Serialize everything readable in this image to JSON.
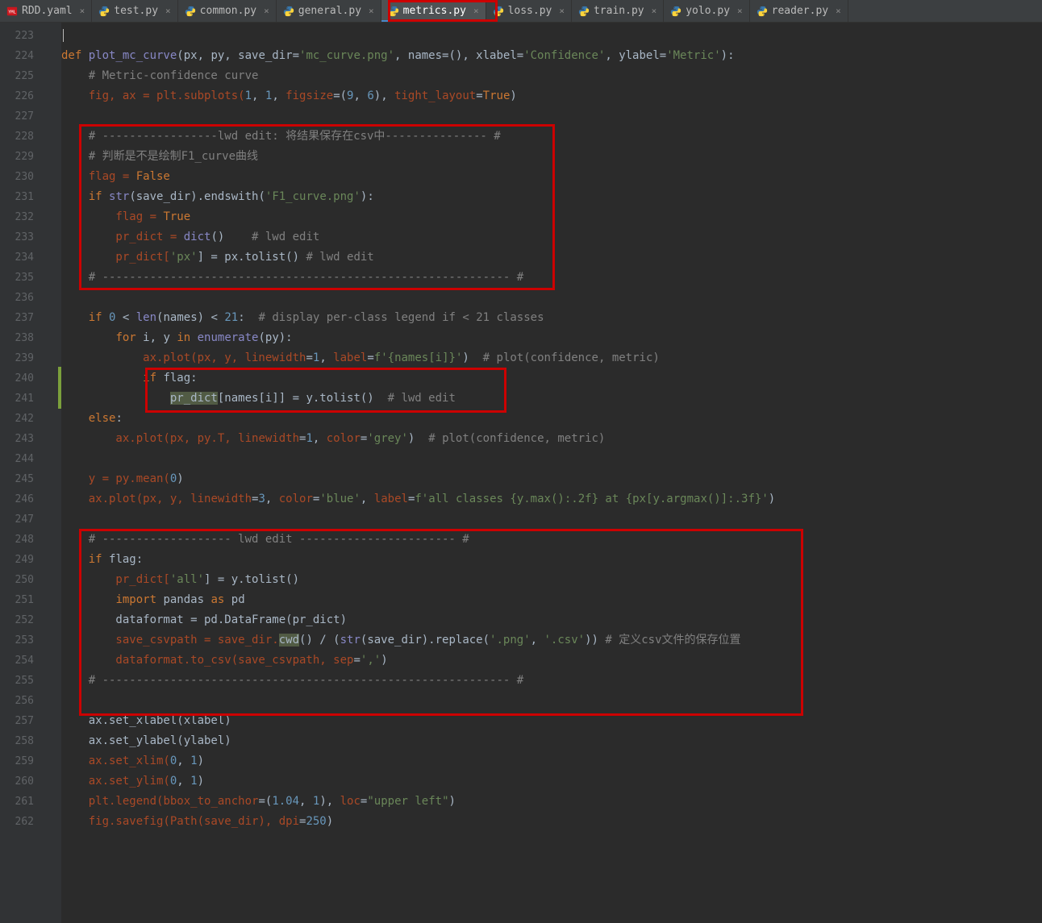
{
  "tabs": [
    {
      "name": "RDD.yaml",
      "type": "yaml",
      "active": false
    },
    {
      "name": "test.py",
      "type": "py",
      "active": false
    },
    {
      "name": "common.py",
      "type": "py",
      "active": false
    },
    {
      "name": "general.py",
      "type": "py",
      "active": false
    },
    {
      "name": "metrics.py",
      "type": "py",
      "active": true
    },
    {
      "name": "loss.py",
      "type": "py",
      "active": false
    },
    {
      "name": "train.py",
      "type": "py",
      "active": false
    },
    {
      "name": "yolo.py",
      "type": "py",
      "active": false
    },
    {
      "name": "reader.py",
      "type": "py",
      "active": false
    }
  ],
  "lineStart": 223,
  "lineEnd": 262,
  "code": {
    "l223": "",
    "l224": {
      "kw": "def ",
      "fn": "plot_mc_curve",
      "txt": "(px, py, save_dir=",
      "s1": "'mc_curve.png'",
      "c1": ", names=(), xlabel=",
      "s2": "'Confidence'",
      "c2": ", ylabel=",
      "s3": "'Metric'",
      "end": "):"
    },
    "l225": "    # Metric-confidence curve",
    "l226": {
      "pre": "    fig, ax = plt.subplots(",
      "n1": "1",
      "c1": ", ",
      "n2": "1",
      "c2": ", ",
      "p1": "figsize",
      "eq1": "=(",
      "n3": "9",
      "c3": ", ",
      "n4": "6",
      "end1": "), ",
      "p2": "tight_layout",
      "eq2": "=",
      "kw": "True",
      "end": ")"
    },
    "l227": "",
    "l228": "    # -----------------lwd edit: 将结果保存在csv中--------------- #",
    "l229": "    # 判断是不是绘制F1_curve曲线",
    "l230": {
      "pre": "    flag = ",
      "kw": "False"
    },
    "l231": {
      "pre": "    ",
      "kw": "if ",
      "fn": "str",
      "txt": "(save_dir).endswith(",
      "s": "'F1_curve.png'",
      "end": "):"
    },
    "l232": {
      "pre": "        flag = ",
      "kw": "True"
    },
    "l233": {
      "pre": "        pr_dict = ",
      "fn": "dict",
      "txt": "()    ",
      "com": "# lwd edit"
    },
    "l234": {
      "pre": "        pr_dict[",
      "s": "'px'",
      "txt": "] = px.tolist() ",
      "com": "# lwd edit"
    },
    "l235": "    # ------------------------------------------------------------ #",
    "l236": "",
    "l237": {
      "pre": "    ",
      "kw1": "if ",
      "n1": "0",
      "txt1": " < ",
      "fn": "len",
      "txt2": "(names) < ",
      "n2": "21",
      "txt3": ":  ",
      "com": "# display per-class legend if < 21 classes"
    },
    "l238": {
      "pre": "        ",
      "kw": "for ",
      "txt1": "i, y ",
      "kw2": "in ",
      "fn": "enumerate",
      "txt2": "(py):"
    },
    "l239": {
      "pre": "            ax.plot(px, y, ",
      "p1": "linewidth",
      "eq1": "=",
      "n1": "1",
      "c1": ", ",
      "p2": "label",
      "eq2": "=",
      "s1": "f'",
      "sb": "{",
      "se": "names[i]",
      "sb2": "}",
      "s2": "'",
      "txt": ")  ",
      "com": "# plot(confidence, metric)"
    },
    "l240": {
      "pre": "            ",
      "kw": "if ",
      "txt": "flag:"
    },
    "l241": {
      "pre": "                ",
      "hl": "pr_dict",
      "txt": "[names[i]] = y.tolist()  ",
      "com": "# lwd edit"
    },
    "l242": {
      "pre": "    ",
      "kw": "else",
      "txt": ":"
    },
    "l243": {
      "pre": "        ax.plot(px, py.T, ",
      "p1": "linewidth",
      "eq1": "=",
      "n1": "1",
      "c1": ", ",
      "p2": "color",
      "eq2": "=",
      "s": "'grey'",
      "txt": ")  ",
      "com": "# plot(confidence, metric)"
    },
    "l244": "",
    "l245": {
      "pre": "    y = py.mean(",
      "n": "0",
      "txt": ")"
    },
    "l246": {
      "pre": "    ax.plot(px, y, ",
      "p1": "linewidth",
      "eq1": "=",
      "n1": "3",
      "c1": ", ",
      "p2": "color",
      "eq2": "=",
      "s1": "'blue'",
      "c2": ", ",
      "p3": "label",
      "eq3": "=",
      "s2": "f'all classes ",
      "sb1": "{",
      "se1": "y.max()",
      "fmt1": ":.2f",
      "sb2": "}",
      "s3": " at ",
      "sb3": "{",
      "se2": "px[y.argmax()]",
      "fmt2": ":.3f",
      "sb4": "}",
      "s4": "'",
      "txt": ")"
    },
    "l247": "",
    "l248": "    # ------------------- lwd edit ----------------------- #",
    "l249": {
      "pre": "    ",
      "kw": "if ",
      "txt": "flag:"
    },
    "l250": {
      "pre": "        pr_dict[",
      "s": "'all'",
      "txt": "] = y.tolist()"
    },
    "l251": {
      "pre": "        ",
      "kw": "import ",
      "txt": "pandas ",
      "kw2": "as ",
      "txt2": "pd"
    },
    "l252": "        dataformat = pd.DataFrame(pr_dict)",
    "l253": {
      "pre": "        save_csvpath = save_dir.",
      "hl": "cwd",
      "txt": "() / (",
      "fn": "str",
      "txt2": "(save_dir).replace(",
      "s1": "'.png'",
      "c": ", ",
      "s2": "'.csv'",
      "txt3": ")) ",
      "com": "# 定义csv文件的保存位置"
    },
    "l254": {
      "pre": "        dataformat.to_csv(save_csvpath, ",
      "p": "sep",
      "eq": "=",
      "s": "','",
      "txt": ")"
    },
    "l255": "    # ------------------------------------------------------------ #",
    "l256": "",
    "l257": "    ax.set_xlabel(xlabel)",
    "l258": "    ax.set_ylabel(ylabel)",
    "l259": {
      "pre": "    ax.set_xlim(",
      "n1": "0",
      "c": ", ",
      "n2": "1",
      "txt": ")"
    },
    "l260": {
      "pre": "    ax.set_ylim(",
      "n1": "0",
      "c": ", ",
      "n2": "1",
      "txt": ")"
    },
    "l261": {
      "pre": "    plt.legend(",
      "p1": "bbox_to_anchor",
      "eq1": "=(",
      "n1": "1.04",
      "c1": ", ",
      "n2": "1",
      "txt1": "), ",
      "p2": "loc",
      "eq2": "=",
      "s": "\"upper left\"",
      "txt2": ")"
    },
    "l262": {
      "pre": "    fig.savefig(Path(save_dir), ",
      "p": "dpi",
      "eq": "=",
      "n": "250",
      "txt": ")"
    }
  }
}
